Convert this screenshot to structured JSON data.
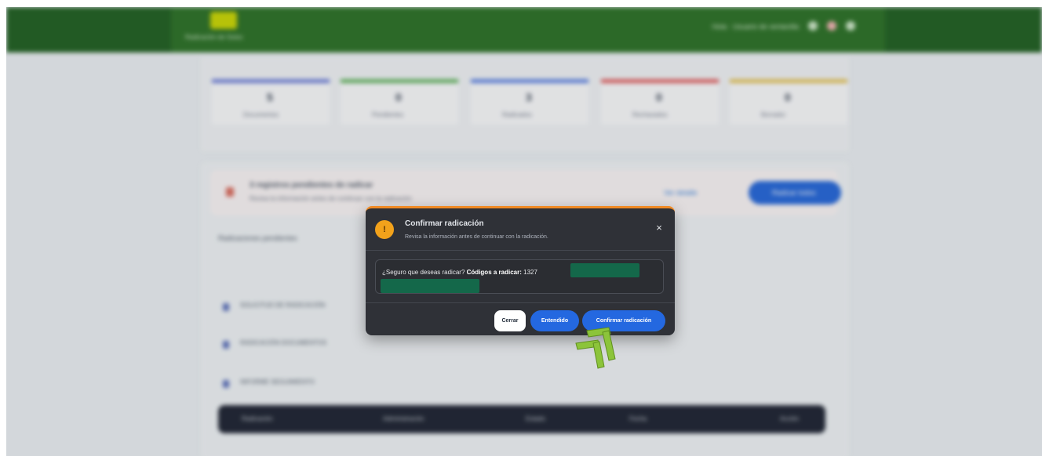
{
  "background_app": {
    "logo_subtitle": "Radicación de Sotos",
    "user_text": "Hola · Usuario de ventanilla",
    "stats": [
      {
        "value": "5",
        "label": "Documentos",
        "color": "#6b7bd6"
      },
      {
        "value": "0",
        "label": "Pendientes",
        "color": "#5fb15a"
      },
      {
        "value": "3",
        "label": "Radicados",
        "color": "#5b7fe0"
      },
      {
        "value": "0",
        "label": "Rechazados",
        "color": "#e05b5b"
      },
      {
        "value": "0",
        "label": "Borrador",
        "color": "#e4c052"
      }
    ],
    "alert_title": "3 registros pendientes de radicar",
    "alert_text": "Revisa la información antes de continuar con la radicación",
    "alert_btn_secondary": "Ver detalle",
    "alert_btn_primary": "Radicar todos",
    "section_title": "Radicaciones pendientes",
    "items": [
      "SOLICITUD DE RADICACIÓN",
      "RADICACIÓN DOCUMENTOS",
      "INFORME SEGUIMIENTO"
    ],
    "table_headers": [
      "Radicación",
      "Administración",
      "Estado",
      "Fecha",
      "Acción"
    ]
  },
  "modal": {
    "icon_glyph": "!",
    "title": "Confirmar radicación",
    "subtitle": "Revisa la información antes de continuar con la radicación.",
    "close_glyph": "×",
    "question": "¿Seguro que deseas radicar?",
    "codes_label": "Códigos a radicar:",
    "codes_value": "1327",
    "buttons": {
      "close": "Cerrar",
      "understood": "Entendido",
      "confirm": "Confirmar radicación"
    }
  },
  "colors": {
    "topbar": "#2b6f24",
    "modal_bg": "#2f3137",
    "modal_accent": "#f08a24",
    "primary": "#2468e0",
    "cursor": "#8cc43a"
  }
}
